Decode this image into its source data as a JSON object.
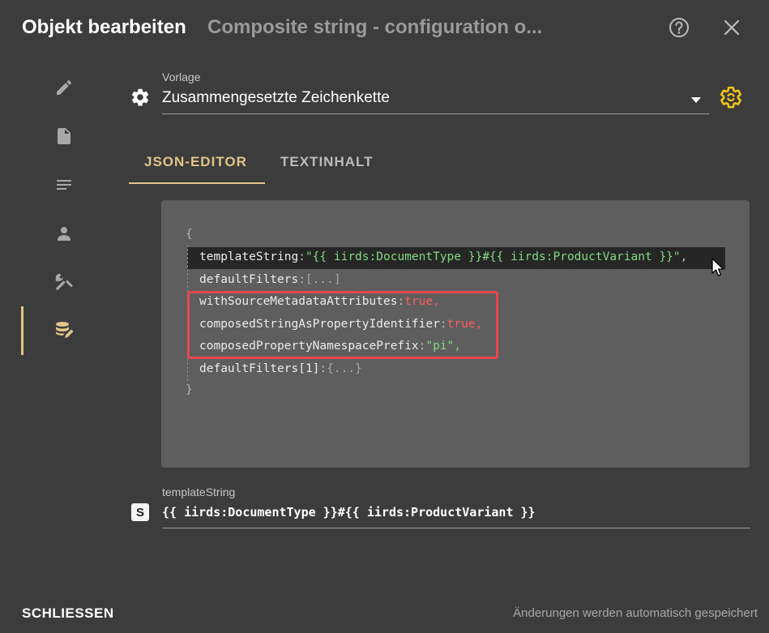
{
  "header": {
    "title": "Objekt bearbeiten",
    "subtitle": "Composite string - configuration o..."
  },
  "sidebar": {
    "items": [
      {
        "icon": "pencil-icon"
      },
      {
        "icon": "document-icon"
      },
      {
        "icon": "lines-icon"
      },
      {
        "icon": "person-icon"
      },
      {
        "icon": "tools-icon"
      },
      {
        "icon": "database-edit-icon",
        "active": true
      }
    ]
  },
  "template": {
    "label": "Vorlage",
    "value": "Zusammengesetzte Zeichenkette"
  },
  "tabs": [
    {
      "label": "JSON-EDITOR",
      "active": true
    },
    {
      "label": "TEXTINHALT",
      "active": false
    }
  ],
  "json_editor": {
    "open_brace": "{",
    "close_brace": "}",
    "lines": [
      {
        "key": "templateString",
        "value": "\"{{ iirds:DocumentType }}#{{ iirds:ProductVariant }}\"",
        "type": "string",
        "comma": ","
      },
      {
        "key": "defaultFilters",
        "value": "[...]",
        "type": "collapsed",
        "comma": ""
      },
      {
        "key": "withSourceMetadataAttributes",
        "value": "true",
        "type": "bool",
        "comma": ","
      },
      {
        "key": "composedStringAsPropertyIdentifier",
        "value": "true",
        "type": "bool",
        "comma": ","
      },
      {
        "key": "composedPropertyNamespacePrefix",
        "value": "\"pi\"",
        "type": "string",
        "comma": ","
      },
      {
        "key": "defaultFilters[1]",
        "value": "{...}",
        "type": "collapsed",
        "comma": ""
      }
    ]
  },
  "template_string_field": {
    "label": "templateString",
    "badge": "S",
    "value": "{{ iirds:DocumentType }}#{{ iirds:ProductVariant }}"
  },
  "footer": {
    "close_label": "SCHLIESSEN",
    "status": "Änderungen werden automatisch gespeichert"
  },
  "colors": {
    "background": "#3c3c3c",
    "accent": "#e2c689",
    "editor_bg": "#5e5e5e",
    "string": "#7fdc7f",
    "boolean": "#ff5c5c",
    "highlight_box": "#e5484d",
    "settings_icon": "#f5c518"
  }
}
